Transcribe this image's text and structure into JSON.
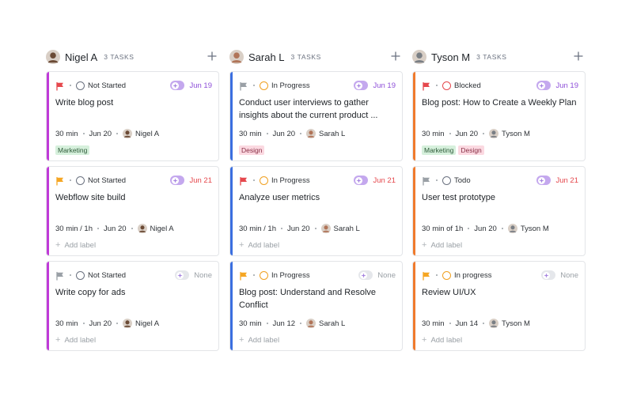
{
  "colors": {
    "purple": "#c03ad8",
    "blue": "#3b6fe0",
    "orange": "#f07a2c",
    "flag_red": "#e5484d",
    "flag_yellow": "#f5a623",
    "flag_gray": "#9aa0a6",
    "date_purple": "#8e4fd8",
    "date_red": "#e5484d",
    "date_gray": "#9aa0a6",
    "ring_gray": "#6b7280",
    "ring_orange": "#f0a020",
    "ring_red": "#e5484d"
  },
  "columns": [
    {
      "name": "Nigel A",
      "count": "3 TASKS",
      "avatar_color": "#6b4a35",
      "cards": [
        {
          "flag": "red-flag",
          "status": "Not Started",
          "ai": "on",
          "due": "Jun 19",
          "due_color": "purple",
          "title": "Write blog post",
          "estimate": "30 min",
          "date": "Jun 20",
          "assignee": "Nigel A",
          "labels": [
            "Marketing"
          ],
          "add_label": ""
        },
        {
          "flag": "yellow-flag",
          "status": "Not Started",
          "ai": "on",
          "due": "Jun 21",
          "due_color": "red",
          "title": "Webflow site build",
          "estimate": "30 min / 1h",
          "date": "Jun 20",
          "assignee": "Nigel A",
          "labels": [],
          "add_label": "Add label"
        },
        {
          "flag": "gray-flag",
          "status": "Not Started",
          "ai": "off",
          "due": "None",
          "due_color": "gray",
          "title": "Write copy for ads",
          "estimate": "30 min",
          "date": "Jun 20",
          "assignee": "Nigel A",
          "labels": [],
          "add_label": "Add label"
        }
      ]
    },
    {
      "name": "Sarah L",
      "count": "3 TASKS",
      "avatar_color": "#b07458",
      "cards": [
        {
          "flag": "gray-flag",
          "status": "In Progress",
          "ai": "on",
          "due": "Jun 19",
          "due_color": "purple",
          "title": "Conduct user interviews to gather insights about the current product ...",
          "estimate": "30 min",
          "date": "Jun 20",
          "assignee": "Sarah L",
          "labels": [
            "Design"
          ],
          "add_label": ""
        },
        {
          "flag": "red-flag",
          "status": "In Progress",
          "ai": "on",
          "due": "Jun 21",
          "due_color": "red",
          "title": "Analyze user metrics",
          "estimate": "30 min / 1h",
          "date": "Jun 20",
          "assignee": "Sarah L",
          "labels": [],
          "add_label": "Add label"
        },
        {
          "flag": "yellow-flag",
          "status": "In Progress",
          "ai": "off",
          "due": "None",
          "due_color": "gray",
          "title": "Blog post: Understand and Resolve Conflict",
          "estimate": "30 min",
          "date": "Jun 12",
          "assignee": "Sarah L",
          "labels": [],
          "add_label": "Add label"
        }
      ]
    },
    {
      "name": "Tyson M",
      "count": "3 TASKS",
      "avatar_color": "#7a7f85",
      "cards": [
        {
          "flag": "red-flag",
          "status": "Blocked",
          "ai": "on",
          "due": "Jun 19",
          "due_color": "purple",
          "title": "Blog post: How to Create a Weekly Plan",
          "estimate": "30 min",
          "date": "Jun 20",
          "assignee": "Tyson M",
          "labels": [
            "Marketing",
            "Design"
          ],
          "add_label": ""
        },
        {
          "flag": "gray-flag",
          "status": "Todo",
          "ai": "on",
          "due": "Jun 21",
          "due_color": "red",
          "title": "User test prototype",
          "estimate": "30 min of 1h",
          "date": "Jun 20",
          "assignee": "Tyson M",
          "labels": [],
          "add_label": "Add label"
        },
        {
          "flag": "yellow-flag",
          "status": "In progress",
          "ai": "off",
          "due": "None",
          "due_color": "gray",
          "title": "Review UI/UX",
          "estimate": "30 min",
          "date": "Jun 14",
          "assignee": "Tyson M",
          "labels": [],
          "add_label": "Add label"
        }
      ]
    }
  ]
}
